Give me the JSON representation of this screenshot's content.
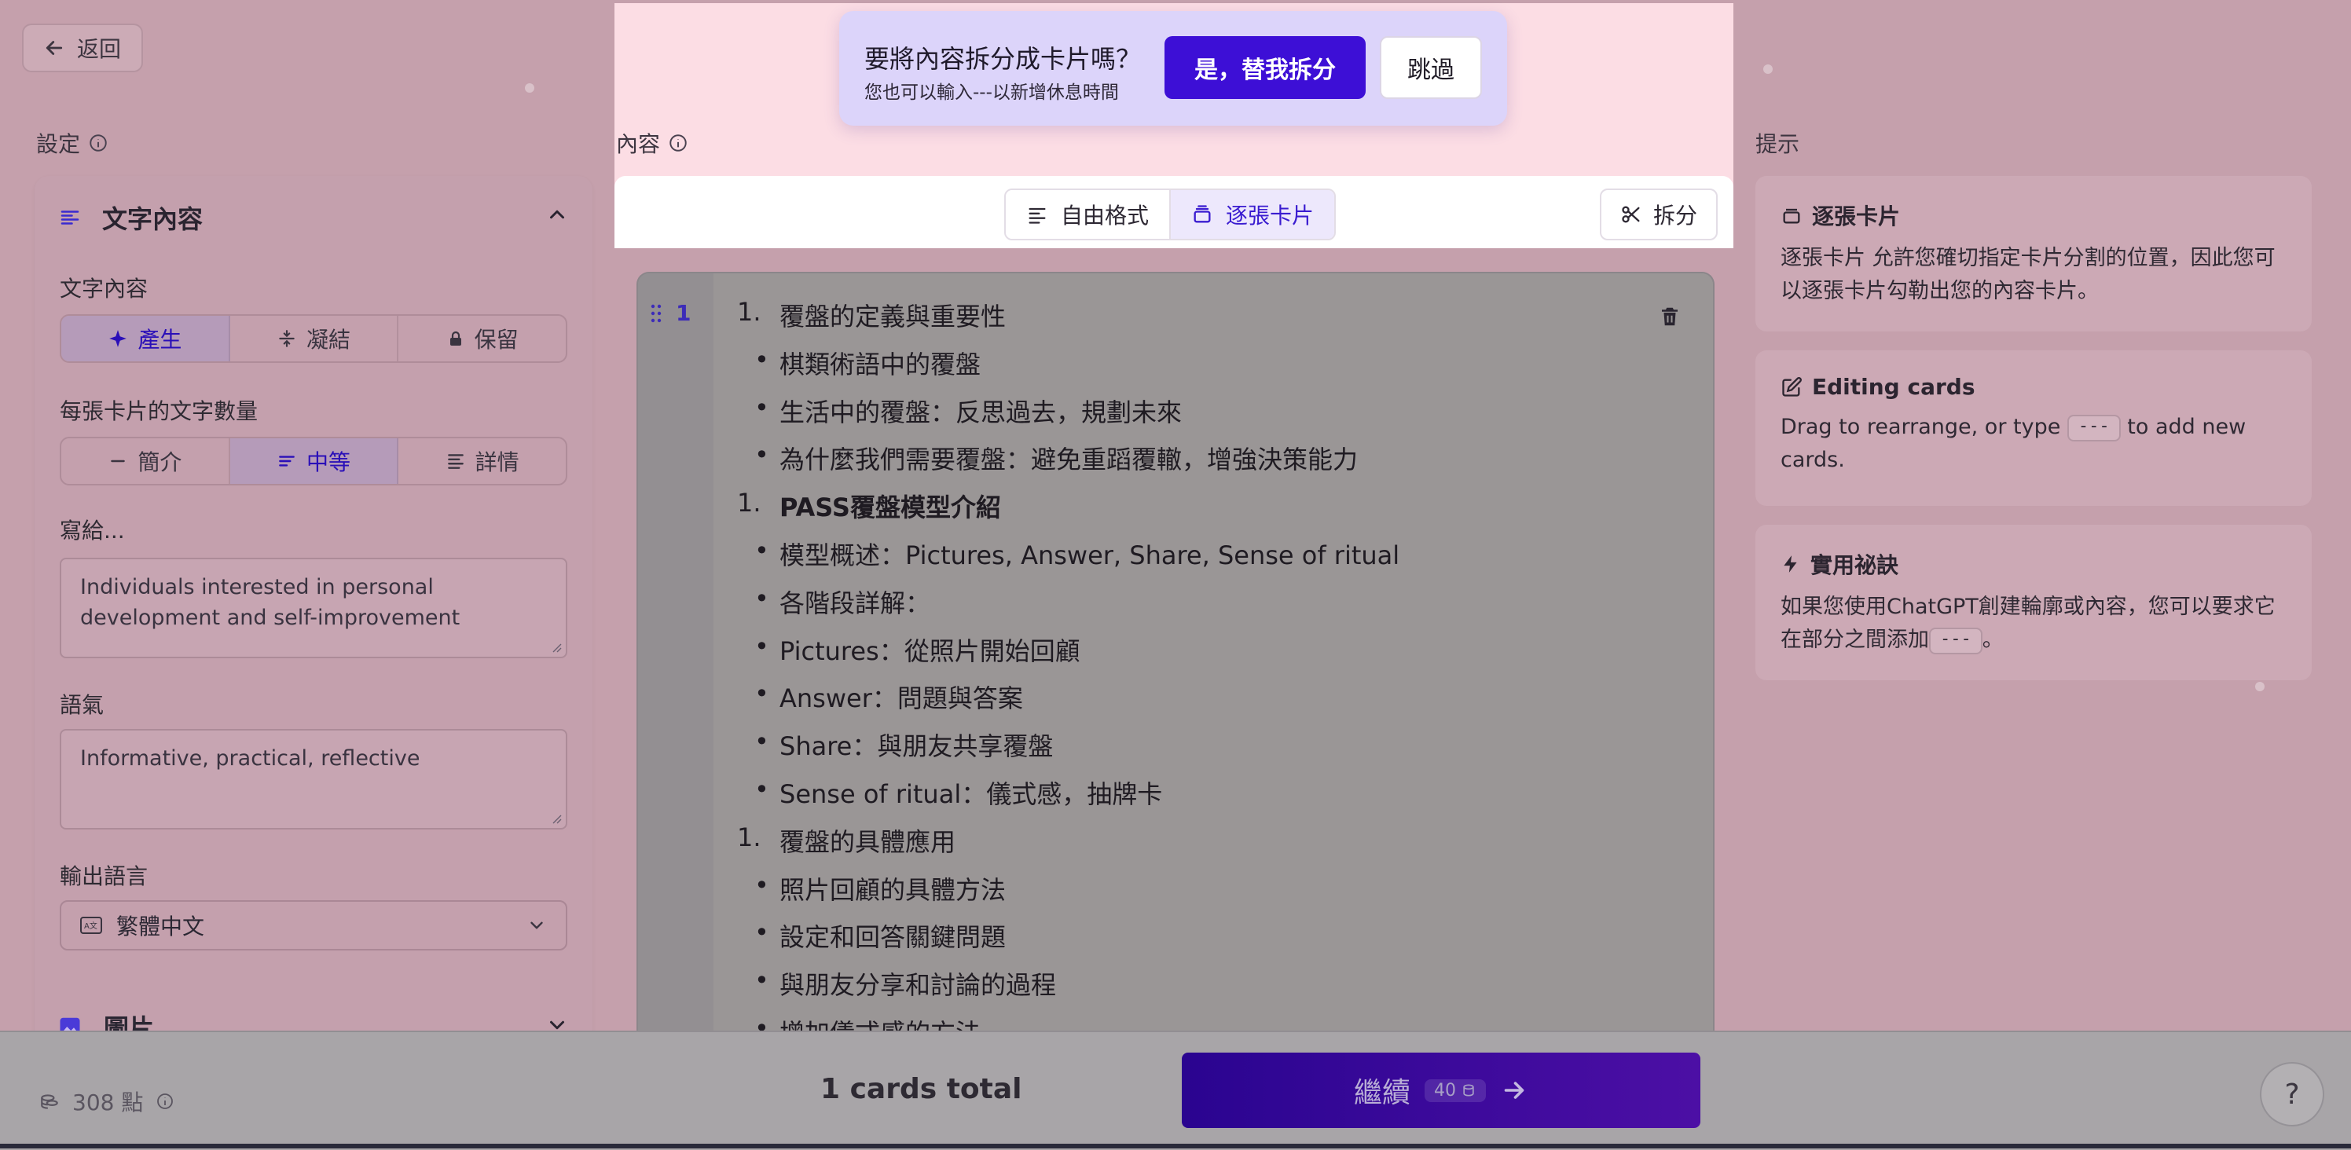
{
  "back": {
    "label": "返回"
  },
  "sections": {
    "settings": "設定",
    "content": "內容",
    "tips": "提示"
  },
  "settings_panel": {
    "header": "文字內容",
    "text_content_label": "文字內容",
    "text_modes": [
      {
        "label": "產生",
        "active": true
      },
      {
        "label": "凝結",
        "active": false
      },
      {
        "label": "保留",
        "active": false
      }
    ],
    "amount_label": "每張卡片的文字數量",
    "amounts": [
      {
        "label": "簡介",
        "active": false
      },
      {
        "label": "中等",
        "active": true
      },
      {
        "label": "詳情",
        "active": false
      }
    ],
    "audience_label": "寫給...",
    "audience_value": "Individuals interested in personal development and self-improvement",
    "tone_label": "語氣",
    "tone_value": "Informative, practical, reflective",
    "language_label": "輸出語言",
    "language_value": "繁體中文",
    "images_label": "圖片"
  },
  "split_prompt": {
    "title": "要將內容拆分成卡片嗎？",
    "subtitle": "您也可以輸入---以新增休息時間",
    "yes": "是，替我拆分",
    "skip": "跳過"
  },
  "toolbar": {
    "freeform": "自由格式",
    "card_by_card": "逐張卡片",
    "split": "拆分"
  },
  "editor": {
    "card_number": "1",
    "lines": [
      {
        "marker": "1.",
        "text": "覆盤的定義與重要性",
        "bold": false
      },
      {
        "marker": "•",
        "text": "棋類術語中的覆盤",
        "bold": false
      },
      {
        "marker": "•",
        "text": "生活中的覆盤：反思過去，規劃未來",
        "bold": false
      },
      {
        "marker": "•",
        "text": "為什麼我們需要覆盤：避免重蹈覆轍，增強決策能力",
        "bold": false
      },
      {
        "marker": "1.",
        "text": "PASS覆盤模型介紹",
        "bold": true
      },
      {
        "marker": "•",
        "text": "模型概述：Pictures, Answer, Share, Sense of ritual",
        "bold": false
      },
      {
        "marker": "•",
        "text": "各階段詳解：",
        "bold": false
      },
      {
        "marker": "•",
        "text": "Pictures：從照片開始回顧",
        "bold": false
      },
      {
        "marker": "•",
        "text": "Answer：問題與答案",
        "bold": false
      },
      {
        "marker": "•",
        "text": "Share：與朋友共享覆盤",
        "bold": false
      },
      {
        "marker": "•",
        "text": "Sense of ritual：儀式感，抽牌卡",
        "bold": false
      },
      {
        "marker": "1.",
        "text": "覆盤的具體應用",
        "bold": false
      },
      {
        "marker": "•",
        "text": "照片回顧的具體方法",
        "bold": false
      },
      {
        "marker": "•",
        "text": "設定和回答關鍵問題",
        "bold": false
      },
      {
        "marker": "•",
        "text": "與朋友分享和討論的過程",
        "bold": false
      },
      {
        "marker": "•",
        "text": "增加儀式感的方法",
        "bold": false
      }
    ]
  },
  "tips": [
    {
      "icon": "cards-icon",
      "title": "逐張卡片",
      "body": "逐張卡片 允許您確切指定卡片分割的位置，因此您可以逐張卡片勾勒出您的內容卡片。"
    },
    {
      "icon": "edit-icon",
      "title": "Editing cards",
      "body_pre": "Drag to rearrange, or type ",
      "kbd": "---",
      "body_post": " to add new cards."
    },
    {
      "icon": "bolt-icon",
      "title": "實用祕訣",
      "body_pre": "如果您使用ChatGPT創建輪廓或內容，您可以要求它在部分之間添加",
      "kbd": "---",
      "body_post": "。"
    }
  ],
  "footer": {
    "points": "308 點",
    "cards_total": "1 cards total",
    "continue": "繼續",
    "credit_cost": "40",
    "help": "?"
  },
  "colors": {
    "accent": "#3d0fd6",
    "highlight": "#fcdde4",
    "backdrop": "#c5a0ac"
  }
}
